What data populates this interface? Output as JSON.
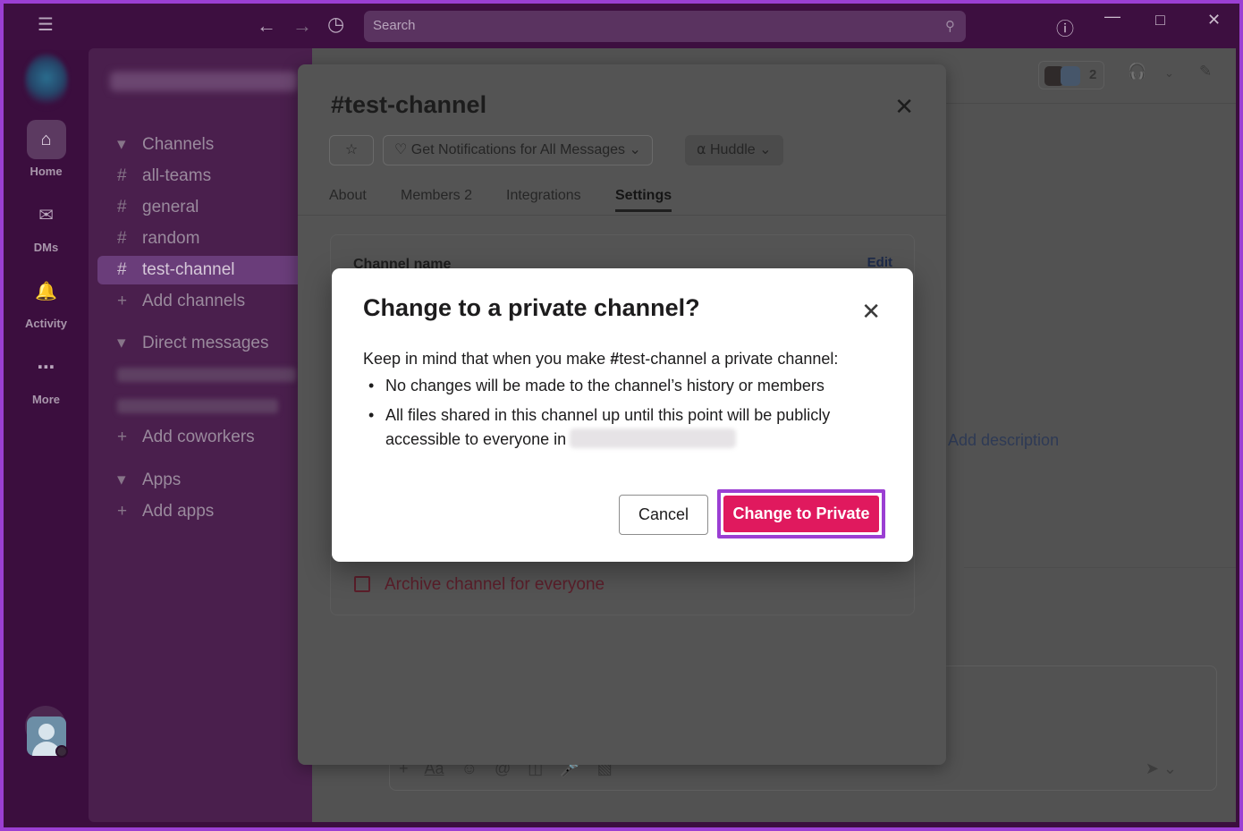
{
  "titlebar": {
    "menu_icon": "hamburger-icon",
    "back_icon": "arrow-left-icon",
    "forward_icon": "arrow-right-icon",
    "history_icon": "clock-icon",
    "search_placeholder": "Search",
    "help_icon": "question-icon",
    "minimize_icon": "minimize-icon",
    "maximize_icon": "maximize-icon",
    "close_icon": "close-icon"
  },
  "rail": {
    "items": [
      {
        "label": "Home",
        "icon": "home-icon",
        "active": true
      },
      {
        "label": "DMs",
        "icon": "dms-icon",
        "active": false
      },
      {
        "label": "Activity",
        "icon": "bell-icon",
        "active": false
      },
      {
        "label": "More",
        "icon": "more-icon",
        "active": false
      }
    ],
    "add_icon": "plus-icon"
  },
  "sidebar": {
    "sections": {
      "channels": "Channels",
      "direct_messages": "Direct messages",
      "apps": "Apps"
    },
    "channels": [
      "all-teams",
      "general",
      "random",
      "test-channel"
    ],
    "active_channel": "test-channel",
    "add_channels": "Add channels",
    "add_coworkers": "Add coworkers",
    "add_apps": "Add apps"
  },
  "main": {
    "member_count": "2",
    "add_description": "Add description"
  },
  "details": {
    "hash": "#",
    "channel_name": "test-channel",
    "notifications_label": "Get Notifications for All Messages",
    "huddle_label": "Huddle",
    "tabs": [
      {
        "label": "About"
      },
      {
        "label": "Members",
        "count": "2"
      },
      {
        "label": "Integrations"
      },
      {
        "label": "Settings",
        "active": true
      }
    ],
    "card_label": "Channel name",
    "card_edit": "Edit",
    "archive_label": "Archive channel for everyone"
  },
  "confirm": {
    "title": "Change to a private channel?",
    "intro_before": "Keep in mind that when you make",
    "hash": "#",
    "channel": "test-channel",
    "intro_after": "a private channel:",
    "bullet_1": "No changes will be made to the channel’s history or members",
    "bullet_2": "All files shared in this channel up until this point will be publicly accessible to everyone in",
    "cancel_label": "Cancel",
    "primary_label": "Change to Private",
    "accent_color": "#e0195e",
    "highlight_color": "#9b3fd3"
  }
}
